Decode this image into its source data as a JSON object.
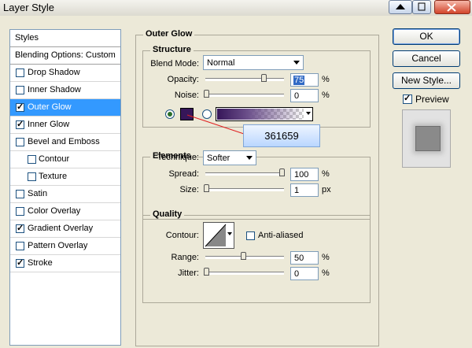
{
  "window": {
    "title": "Layer Style"
  },
  "styles_list": {
    "header": "Styles",
    "blending_options": "Blending Options: Custom",
    "items": [
      {
        "label": "Drop Shadow",
        "checked": false
      },
      {
        "label": "Inner Shadow",
        "checked": false
      },
      {
        "label": "Outer Glow",
        "checked": true,
        "selected": true
      },
      {
        "label": "Inner Glow",
        "checked": true
      },
      {
        "label": "Bevel and Emboss",
        "checked": false
      },
      {
        "label": "Contour",
        "checked": false,
        "indent": true
      },
      {
        "label": "Texture",
        "checked": false,
        "indent": true
      },
      {
        "label": "Satin",
        "checked": false
      },
      {
        "label": "Color Overlay",
        "checked": false
      },
      {
        "label": "Gradient Overlay",
        "checked": true
      },
      {
        "label": "Pattern Overlay",
        "checked": false
      },
      {
        "label": "Stroke",
        "checked": true
      }
    ]
  },
  "outer_glow": {
    "title": "Outer Glow",
    "structure": {
      "title": "Structure",
      "blend_mode_label": "Blend Mode:",
      "blend_mode_value": "Normal",
      "opacity_label": "Opacity:",
      "opacity_value": "75",
      "opacity_unit": "%",
      "noise_label": "Noise:",
      "noise_value": "0",
      "noise_unit": "%",
      "glow_color": "#361659",
      "tooltip": "361659"
    },
    "elements": {
      "title": "Elements",
      "technique_label": "Technique:",
      "technique_value": "Softer",
      "spread_label": "Spread:",
      "spread_value": "100",
      "spread_unit": "%",
      "size_label": "Size:",
      "size_value": "1",
      "size_unit": "px"
    },
    "quality": {
      "title": "Quality",
      "contour_label": "Contour:",
      "anti_aliased_label": "Anti-aliased",
      "range_label": "Range:",
      "range_value": "50",
      "range_unit": "%",
      "jitter_label": "Jitter:",
      "jitter_value": "0",
      "jitter_unit": "%"
    }
  },
  "buttons": {
    "ok": "OK",
    "cancel": "Cancel",
    "new_style": "New Style...",
    "preview": "Preview"
  },
  "colors": {
    "selection": "#3399ff",
    "accent_line": "#e02020",
    "glow": "#361659"
  }
}
